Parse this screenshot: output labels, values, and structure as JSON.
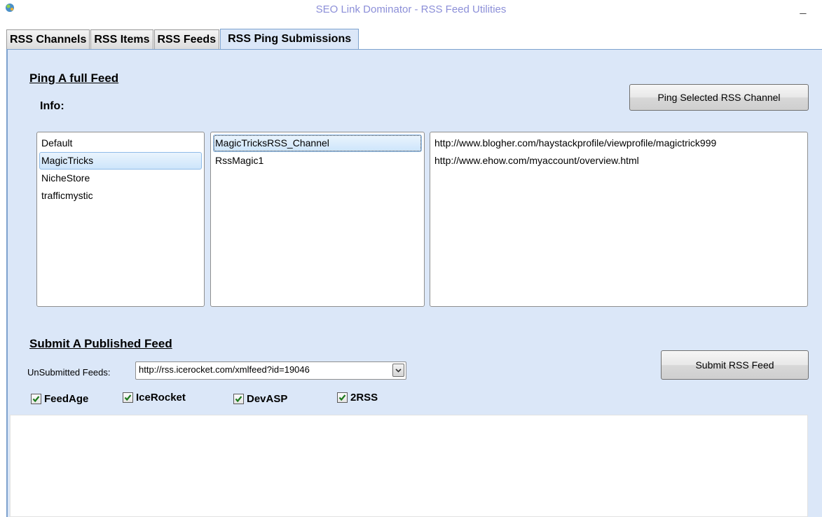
{
  "window": {
    "title": "SEO Link Dominator - RSS Feed Utilities",
    "minimize_glyph": "_"
  },
  "tabs": [
    {
      "label": "RSS Channels"
    },
    {
      "label": "RSS Items"
    },
    {
      "label": "RSS Feeds"
    },
    {
      "label": "RSS Ping Submissions"
    }
  ],
  "ping_section": {
    "title": "Ping A full Feed",
    "info_label": "Info:",
    "ping_button": "Ping Selected RSS Channel",
    "accounts": [
      "Default",
      "MagicTricks",
      "NicheStore",
      "trafficmystic"
    ],
    "selected_account": "MagicTricks",
    "channels": [
      "MagicTricksRSS_Channel",
      "RssMagic1"
    ],
    "selected_channel": "MagicTricksRSS_Channel",
    "urls": [
      "http://www.blogher.com/haystackprofile/viewprofile/magictrick999",
      "http://www.ehow.com/myaccount/overview.html"
    ]
  },
  "submit_section": {
    "title": "Submit A Published Feed",
    "unsubmitted_label": "UnSubmitted Feeds:",
    "feed_value": "http://rss.icerocket.com/xmlfeed?id=19046",
    "submit_button": "Submit RSS Feed",
    "checkboxes": [
      {
        "label": "FeedAge",
        "checked": true
      },
      {
        "label": "IceRocket",
        "checked": true
      },
      {
        "label": "DevASP",
        "checked": true
      },
      {
        "label": "2RSS",
        "checked": true
      }
    ]
  },
  "colors": {
    "panel_bg": "#dbe7f8",
    "title_text": "#8c8fd8",
    "selection_border": "#8fbbe8",
    "check_green": "#1d7a1d"
  }
}
